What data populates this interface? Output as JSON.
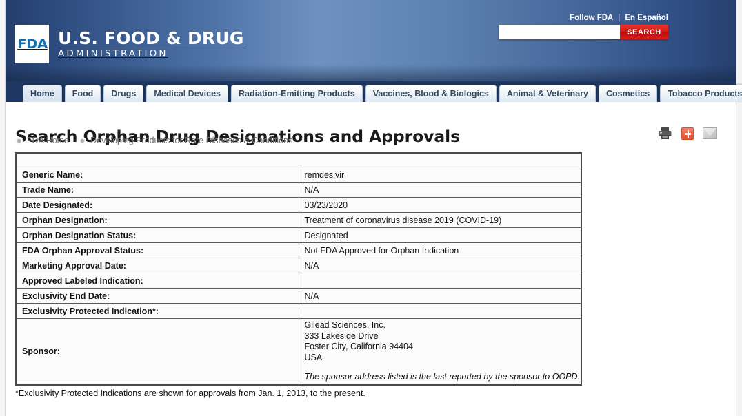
{
  "masthead": {
    "logo_mark": "FDA",
    "agency_line1": "U.S. FOOD & DRUG",
    "agency_line2": "ADMINISTRATION",
    "follow_link": "Follow FDA",
    "separator": "|",
    "espanol_link": "En Español",
    "search_value": "",
    "search_placeholder": "",
    "search_button": "SEARCH"
  },
  "nav": {
    "tabs": [
      {
        "label": "Home",
        "active": true
      },
      {
        "label": "Food",
        "active": false
      },
      {
        "label": "Drugs",
        "active": false
      },
      {
        "label": "Medical Devices",
        "active": false
      },
      {
        "label": "Radiation-Emitting Products",
        "active": false
      },
      {
        "label": "Vaccines, Blood & Biologics",
        "active": false
      },
      {
        "label": "Animal & Veterinary",
        "active": false
      },
      {
        "label": "Cosmetics",
        "active": false
      },
      {
        "label": "Tobacco Products",
        "active": false
      }
    ]
  },
  "page": {
    "title": "Search Orphan Drug Designations and Approvals",
    "breadcrumb": [
      "FDA Home",
      "Developing Products for Rare Diseases & Conditions"
    ],
    "actions": [
      {
        "icon": "print-icon",
        "label": "Print"
      },
      {
        "icon": "share-plus-icon",
        "label": "Share"
      },
      {
        "icon": "email-icon",
        "label": "Email"
      }
    ]
  },
  "record": {
    "header_row": "",
    "rows": [
      {
        "label": "Generic Name:",
        "value": "remdesivir"
      },
      {
        "label": "Trade Name:",
        "value": "N/A"
      },
      {
        "label": "Date Designated:",
        "value": "03/23/2020"
      },
      {
        "label": "Orphan Designation:",
        "value": "Treatment of coronavirus disease 2019 (COVID-19)"
      },
      {
        "label": "Orphan Designation Status:",
        "value": "Designated"
      },
      {
        "label": "FDA Orphan Approval Status:",
        "value": "Not FDA Approved for Orphan Indication"
      },
      {
        "label": "Marketing Approval Date:",
        "value": "N/A"
      },
      {
        "label": "Approved Labeled Indication:",
        "value": ""
      },
      {
        "label": "Exclusivity End Date:",
        "value": "N/A"
      },
      {
        "label": "Exclusivity Protected Indication*:",
        "value": ""
      }
    ],
    "sponsor": {
      "label": "Sponsor:",
      "name": "Gilead Sciences, Inc.",
      "street": "333 Lakeside Drive",
      "city_state_zip": "Foster City, California 94404",
      "country": "USA",
      "note": "The sponsor address listed is the last reported by the sponsor to OOPD."
    }
  },
  "footnote": "*Exclusivity Protected Indications are shown for approvals from Jan. 1, 2013, to the present.",
  "colors": {
    "header_dark_blue": "#243e6c",
    "header_light_blue": "#6e91bf",
    "nav_bar": "#1f3863",
    "search_red": "#d51a16",
    "share_orange": "#ef6a4e",
    "table_border": "#4a4a4a"
  }
}
